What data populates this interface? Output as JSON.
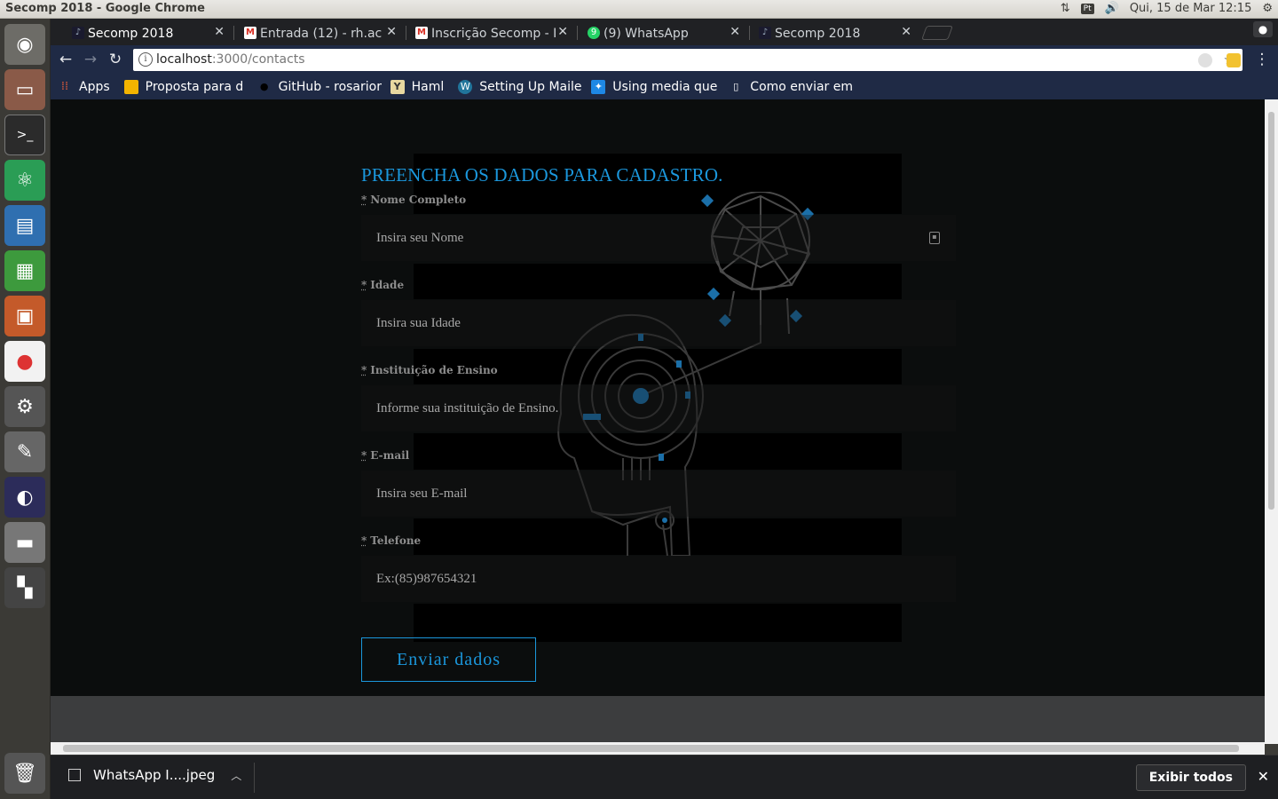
{
  "os": {
    "window_title": "Secomp 2018 - Google Chrome",
    "lang_indicator": "Pt",
    "clock": "Qui, 15 de Mar 12:15"
  },
  "tabs": [
    {
      "title": "Secomp 2018",
      "favicon": "secomp-favicon",
      "active": true
    },
    {
      "title": "Entrada (12) - rh.ac",
      "favicon": "gmail-favicon",
      "active": false
    },
    {
      "title": "Inscrição Secomp - I",
      "favicon": "gmail-favicon",
      "active": false
    },
    {
      "title": "(9) WhatsApp",
      "favicon": "whatsapp-favicon",
      "active": false
    },
    {
      "title": "Secomp 2018",
      "favicon": "secomp-favicon",
      "active": false
    }
  ],
  "address_bar": {
    "host": "localhost",
    "path": ":3000/contacts"
  },
  "bookmarks": [
    {
      "label": "Apps",
      "icon": "apps-grid-icon"
    },
    {
      "label": "Proposta para d",
      "icon": "slides-icon"
    },
    {
      "label": "GitHub - rosarior",
      "icon": "github-icon"
    },
    {
      "label": "Haml",
      "icon": "haml-icon"
    },
    {
      "label": "Setting Up Maile",
      "icon": "wordpress-icon"
    },
    {
      "label": "Using media que",
      "icon": "bookmark-icon"
    },
    {
      "label": "Como enviar em",
      "icon": "page-icon"
    }
  ],
  "form": {
    "title": "PREENCHA OS DADOS PARA CADASTRO.",
    "required_mark": "*",
    "fields": [
      {
        "label": "Nome Completo",
        "placeholder": "Insira seu Nome"
      },
      {
        "label": "Idade",
        "placeholder": "Insira sua Idade"
      },
      {
        "label": "Instituição de Ensino",
        "placeholder": "Informe sua instituição de Ensino."
      },
      {
        "label": "E-mail",
        "placeholder": "Insira seu E-mail"
      },
      {
        "label": "Telefone",
        "placeholder": "Ex:(85)987654321"
      }
    ],
    "submit_label": "Enviar dados"
  },
  "download_shelf": {
    "file_name": "WhatsApp I....jpeg",
    "show_all_label": "Exibir todos"
  },
  "colors": {
    "accent": "#1b97dc",
    "page_bg": "#0b0d0d",
    "chrome_toolbar": "#1f2a45"
  }
}
